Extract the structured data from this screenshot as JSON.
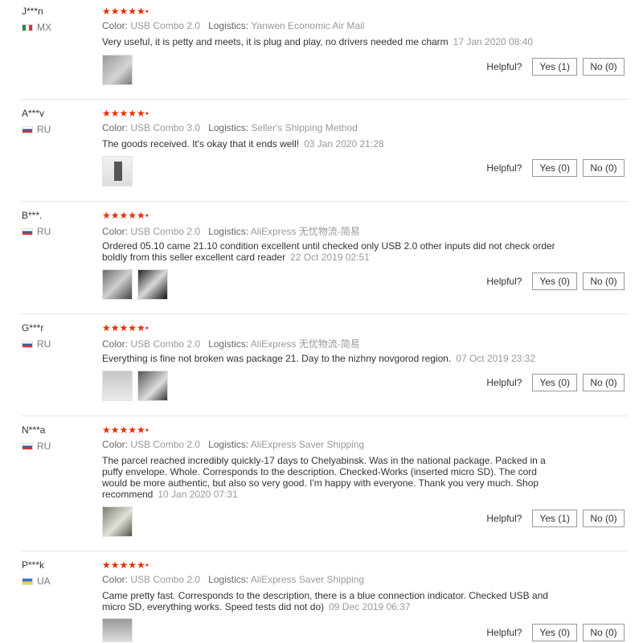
{
  "labels": {
    "color": "Color:",
    "logistics": "Logistics:",
    "helpful": "Helpful?"
  },
  "stars": "★★★★★",
  "reviews": [
    {
      "user": "J***n",
      "country": "MX",
      "color": "USB Combo 2.0",
      "logistics": "Yanwen Economic Air Mail",
      "text": "Very useful, it is petty and meets, it is plug and play, no drivers needed me charm",
      "date": "17 Jan 2020 08:40",
      "yes": "Yes (1)",
      "no": "No (0)"
    },
    {
      "user": "A***v",
      "country": "RU",
      "color": "USB Combo 3.0",
      "logistics": "Seller's Shipping Method",
      "text": "The goods received. It's okay that it ends well!",
      "date": "03 Jan 2020 21:28",
      "yes": "Yes (0)",
      "no": "No (0)"
    },
    {
      "user": "B***.",
      "country": "RU",
      "color": "USB Combo 2.0",
      "logistics": "AliExpress 无忧物流-简易",
      "text": "Ordered 05.10 came 21.10 condition excellent until checked only USB 2.0 other inputs did not check order boldly from this seller excellent card reader",
      "date": "22 Oct 2019 02:51",
      "yes": "Yes (0)",
      "no": "No (0)"
    },
    {
      "user": "G***r",
      "country": "RU",
      "color": "USB Combo 2.0",
      "logistics": "AliExpress 无忧物流-简易",
      "text": "Everything is fine not broken was package 21. Day to the nizhny novgorod region.",
      "date": "07 Oct 2019 23:32",
      "yes": "Yes (0)",
      "no": "No (0)"
    },
    {
      "user": "N***a",
      "country": "RU",
      "color": "USB Combo 2.0",
      "logistics": "AliExpress Saver Shipping",
      "text": "The parcel reached incredibly quickly-17 days to Chelyabinsk. Was in the national package. Packed in a puffy envelope. Whole. Corresponds to the description. Checked-Works (inserted micro SD). The cord would be more authentic, but also so very good. I'm happy with everyone. Thank you very much. Shop recommend",
      "date": "10 Jan 2020 07:31",
      "yes": "Yes (1)",
      "no": "No (0)"
    },
    {
      "user": "P***k",
      "country": "UA",
      "color": "USB Combo 2.0",
      "logistics": "AliExpress Saver Shipping",
      "text": "Came pretty fast. Corresponds to the description, there is a blue connection indicator. Checked USB and micro SD, everything works. Speed tests did not do)",
      "date": "09 Dec 2019 06:37",
      "yes": "Yes (0)",
      "no": "No (0)"
    }
  ]
}
